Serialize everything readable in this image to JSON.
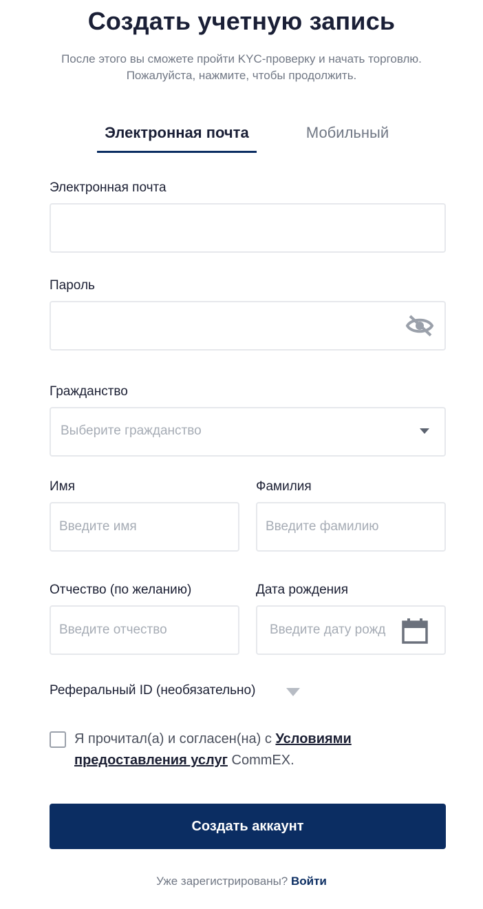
{
  "header": {
    "title": "Создать учетную запись",
    "subtitle_line1": "После этого вы сможете пройти KYC-проверку и начать торговлю.",
    "subtitle_line2": "Пожалуйста, нажмите, чтобы продолжить."
  },
  "tabs": {
    "email": "Электронная почта",
    "mobile": "Мобильный",
    "active": "email"
  },
  "form": {
    "email": {
      "label": "Электронная почта",
      "value": "",
      "placeholder": ""
    },
    "password": {
      "label": "Пароль",
      "value": "",
      "placeholder": ""
    },
    "citizenship": {
      "label": "Гражданство",
      "placeholder": "Выберите гражданство"
    },
    "first_name": {
      "label": "Имя",
      "placeholder": "Введите имя"
    },
    "last_name": {
      "label": "Фамилия",
      "placeholder": "Введите фамилию"
    },
    "middle_name": {
      "label": "Отчество (по желанию)",
      "placeholder": "Введите отчество"
    },
    "birth_date": {
      "label": "Дата рождения",
      "placeholder": "Введите дату рожд"
    },
    "referral_label": "Реферальный ID (необязательно)",
    "terms": {
      "prefix": "Я прочитал(а) и согласен(на) с ",
      "link": "Условиями предоставления услуг",
      "suffix": " CommEX.",
      "checked": false
    },
    "submit_label": "Создать аккаунт"
  },
  "footer": {
    "question": "Уже зарегистрированы? ",
    "login_link": "Войти"
  },
  "colors": {
    "primary": "#0b2d62",
    "text": "#1b1f33",
    "muted": "#707784",
    "border": "#e6e8ec",
    "placeholder": "#a6acb5"
  },
  "icons": {
    "password_toggle": "eye-slash-icon",
    "citizenship_dropdown": "caret-down-icon",
    "birth_date": "calendar-icon",
    "referral_toggle": "caret-down-icon"
  }
}
